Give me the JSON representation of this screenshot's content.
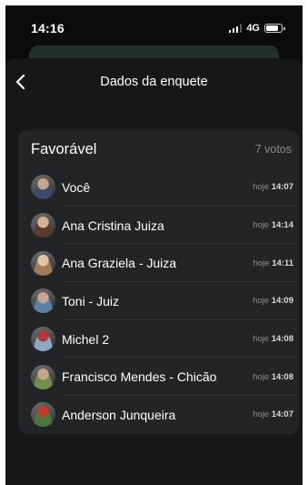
{
  "status_bar": {
    "time": "14:16",
    "network": "4G",
    "battery_level": 0.7
  },
  "header": {
    "title": "Dados da enquete"
  },
  "option": {
    "name": "Favorável",
    "votes": "7 votos"
  },
  "voters": [
    {
      "name": "Você",
      "day": "hoje",
      "time": "14:07",
      "avatar_colors": [
        "#3b4a6b",
        "#c9a48a"
      ]
    },
    {
      "name": "Ana Cristina Juiza",
      "day": "hoje",
      "time": "14:14",
      "avatar_colors": [
        "#5a3b2e",
        "#d6b08e"
      ]
    },
    {
      "name": "Ana Graziela - Juiza",
      "day": "hoje",
      "time": "14:11",
      "avatar_colors": [
        "#a07a55",
        "#e2c3a0"
      ]
    },
    {
      "name": "Toni - Juiz",
      "day": "hoje",
      "time": "14:09",
      "avatar_colors": [
        "#5a7fa8",
        "#c9a48a"
      ]
    },
    {
      "name": "Michel 2",
      "day": "hoje",
      "time": "14:08",
      "avatar_colors": [
        "#8fa6c0",
        "#b03a3a"
      ]
    },
    {
      "name": "Francisco Mendes - Chicão",
      "day": "hoje",
      "time": "14:08",
      "avatar_colors": [
        "#6f8f4a",
        "#c9a48a"
      ]
    },
    {
      "name": "Anderson Junqueira",
      "day": "hoje",
      "time": "14:07",
      "avatar_colors": [
        "#4a7a3a",
        "#c0392b"
      ]
    }
  ]
}
